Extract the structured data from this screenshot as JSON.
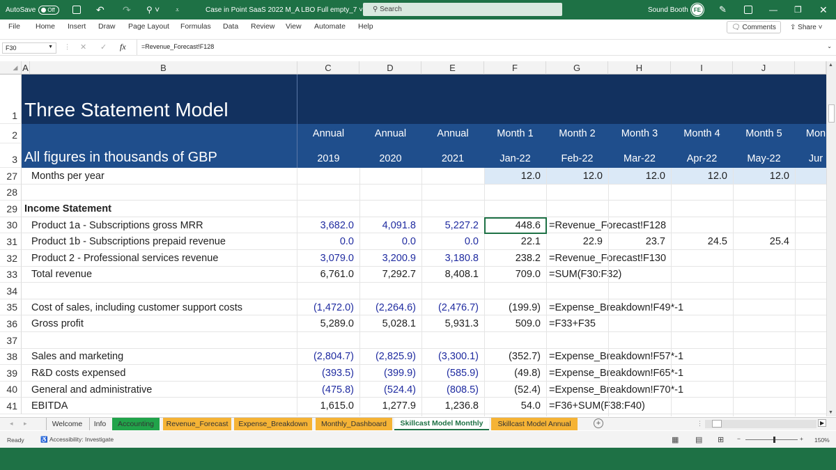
{
  "titlebar": {
    "autosave_label": "AutoSave",
    "autosave_state": "Off",
    "filename": "Case in Point SaaS 2022 M_A LBO Full empty_7",
    "search_placeholder": "Search",
    "user_name": "Sound Booth",
    "user_initials": "FE"
  },
  "menu": {
    "items": [
      "File",
      "Home",
      "Insert",
      "Draw",
      "Page Layout",
      "Formulas",
      "Data",
      "Review",
      "View",
      "Automate",
      "Help"
    ],
    "comments_label": "Comments",
    "share_label": "Share"
  },
  "formula_bar": {
    "name_box": "F30",
    "fx_label": "fx",
    "formula": "=Revenue_Forecast!F128"
  },
  "columns": [
    "A",
    "B",
    "C",
    "D",
    "E",
    "F",
    "G",
    "H",
    "I",
    "J"
  ],
  "header": {
    "title": "Three Statement Model",
    "subtitle": "All figures in thousands of GBP",
    "period_types": [
      "Annual",
      "Annual",
      "Annual",
      "Month 1",
      "Month 2",
      "Month 3",
      "Month 4",
      "Month 5",
      "Mon"
    ],
    "period_labels": [
      "2019",
      "2020",
      "2021",
      "Jan-22",
      "Feb-22",
      "Mar-22",
      "Apr-22",
      "May-22",
      "Jur"
    ]
  },
  "row_numbers": {
    "r1": "1",
    "r2": "2",
    "r3": "3"
  },
  "rows": [
    {
      "num": "27",
      "label": "Months per year",
      "values": [
        "",
        "",
        "",
        "12.0",
        "12.0",
        "12.0",
        "12.0",
        "12.0"
      ]
    },
    {
      "num": "28",
      "label": "",
      "values": [
        "",
        "",
        "",
        "",
        "",
        "",
        "",
        ""
      ]
    },
    {
      "num": "29",
      "label": "Income Statement",
      "values": [
        "",
        "",
        "",
        "",
        "",
        "",
        "",
        ""
      ]
    },
    {
      "num": "30",
      "label": "Product 1a - Subscriptions gross MRR",
      "values": [
        "3,682.0",
        "4,091.8",
        "5,227.2",
        "448.6",
        "=Revenue_Forecast!F128",
        "",
        "",
        ""
      ]
    },
    {
      "num": "31",
      "label": "Product 1b - Subscriptions prepaid revenue",
      "values": [
        "0.0",
        "0.0",
        "0.0",
        "22.1",
        "22.9",
        "23.7",
        "24.5",
        "25.4"
      ]
    },
    {
      "num": "32",
      "label": "Product 2 - Professional services revenue",
      "values": [
        "3,079.0",
        "3,200.9",
        "3,180.8",
        "238.2",
        "=Revenue_Forecast!F130",
        "",
        "",
        ""
      ]
    },
    {
      "num": "33",
      "label": "Total revenue",
      "values": [
        "6,761.0",
        "7,292.7",
        "8,408.1",
        "709.0",
        "=SUM(F30:F32)",
        "",
        "",
        ""
      ]
    },
    {
      "num": "34",
      "label": "",
      "values": [
        "",
        "",
        "",
        "",
        "",
        "",
        "",
        ""
      ]
    },
    {
      "num": "35",
      "label": "Cost of sales, including customer support costs",
      "values": [
        "(1,472.0)",
        "(2,264.6)",
        "(2,476.7)",
        "(199.9)",
        "=Expense_Breakdown!F49*-1",
        "",
        "",
        ""
      ]
    },
    {
      "num": "36",
      "label": "Gross profit",
      "values": [
        "5,289.0",
        "5,028.1",
        "5,931.3",
        "509.0",
        "=F33+F35",
        "",
        "",
        ""
      ]
    },
    {
      "num": "37",
      "label": "",
      "values": [
        "",
        "",
        "",
        "",
        "",
        "",
        "",
        ""
      ]
    },
    {
      "num": "38",
      "label": "Sales and marketing",
      "values": [
        "(2,804.7)",
        "(2,825.9)",
        "(3,300.1)",
        "(352.7)",
        "=Expense_Breakdown!F57*-1",
        "",
        "",
        ""
      ]
    },
    {
      "num": "39",
      "label": "R&D costs expensed",
      "values": [
        "(393.5)",
        "(399.9)",
        "(585.9)",
        "(49.8)",
        "=Expense_Breakdown!F65*-1",
        "",
        "",
        ""
      ]
    },
    {
      "num": "40",
      "label": "General and administrative",
      "values": [
        "(475.8)",
        "(524.4)",
        "(808.5)",
        "(52.4)",
        "=Expense_Breakdown!F70*-1",
        "",
        "",
        ""
      ]
    },
    {
      "num": "41",
      "label": "EBITDA",
      "values": [
        "1,615.0",
        "1,277.9",
        "1,236.8",
        "54.0",
        "=F36+SUM(F38:F40)",
        "",
        "",
        ""
      ]
    }
  ],
  "sheet_tabs": [
    {
      "label": "Welcome",
      "color": "#f3f3f3"
    },
    {
      "label": "Info",
      "color": "#f3f3f3"
    },
    {
      "label": "Accounting",
      "color": "#21a34a"
    },
    {
      "label": "Revenue_Forecast",
      "color": "#f5b335"
    },
    {
      "label": "Expense_Breakdown",
      "color": "#f5b335"
    },
    {
      "label": "Monthly_Dashboard",
      "color": "#f5b335"
    },
    {
      "label": "Skillcast Model Monthly",
      "color": "#ffffff"
    },
    {
      "label": "Skillcast Model Annual",
      "color": "#f5b335"
    }
  ],
  "status": {
    "ready": "Ready",
    "accessibility": "Accessibility: Investigate",
    "zoom": "150%"
  },
  "colors": {
    "excel_green": "#1e7145",
    "header_navy": "#12315f",
    "header_blue": "#1f4e8c",
    "input_blue": "#1f2ba0",
    "highlight": "#dbe9f7"
  }
}
